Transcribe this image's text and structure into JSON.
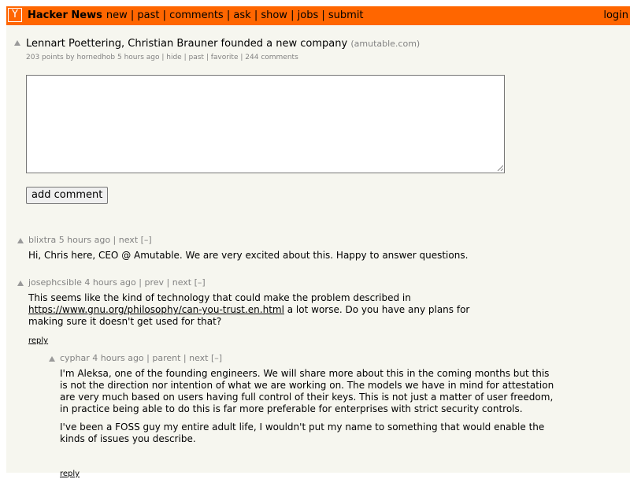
{
  "header": {
    "logo": "Y",
    "brand": "Hacker News",
    "nav": [
      "new",
      "past",
      "comments",
      "ask",
      "show",
      "jobs",
      "submit"
    ],
    "separator": "|",
    "login": "login"
  },
  "story": {
    "title": "Lennart Poettering, Christian Brauner founded a new company",
    "site": "(amutable.com)",
    "points": "203 points",
    "by": "by",
    "user": "hornedhob",
    "age": "5 hours ago",
    "links": [
      "hide",
      "past",
      "favorite",
      "244 comments"
    ]
  },
  "form": {
    "textarea_value": "",
    "button": "add comment"
  },
  "comments": [
    {
      "user": "blixtra",
      "age": "5 hours ago",
      "nav": [
        "next"
      ],
      "toggle": "[–]",
      "text": [
        "Hi, Chris here, CEO @ Amutable. We are very excited about this. Happy to answer questions."
      ],
      "reply": ""
    },
    {
      "user": "josephcsible",
      "age": "4 hours ago",
      "nav": [
        "prev",
        "next"
      ],
      "toggle": "[–]",
      "text_before": "This seems like the kind of technology that could make the problem described in",
      "link": "https://www.gnu.org/philosophy/can-you-trust.en.html",
      "text_after": "a lot worse. Do you have any plans for making sure it doesn't get used for that?",
      "reply": "reply"
    },
    {
      "user": "cyphar",
      "age": "4 hours ago",
      "nav": [
        "parent",
        "next"
      ],
      "toggle": "[–]",
      "text": [
        "I'm Aleksa, one of the founding engineers. We will share more about this in the coming months but this is not the direction nor intention of what we are working on. The models we have in mind for attestation are very much based on users having full control of their keys. This is not just a matter of user freedom, in practice being able to do this is far more preferable for enterprises with strict security controls.",
        "I've been a FOSS guy my entire adult life, I wouldn't put my name to something that would enable the kinds of issues you describe."
      ],
      "reply": "reply"
    }
  ],
  "colors": {
    "header_bg": "#ff6600",
    "page_bg": "#f6f6ef",
    "subtext": "#828282",
    "arrow": "#9a9a9a"
  }
}
